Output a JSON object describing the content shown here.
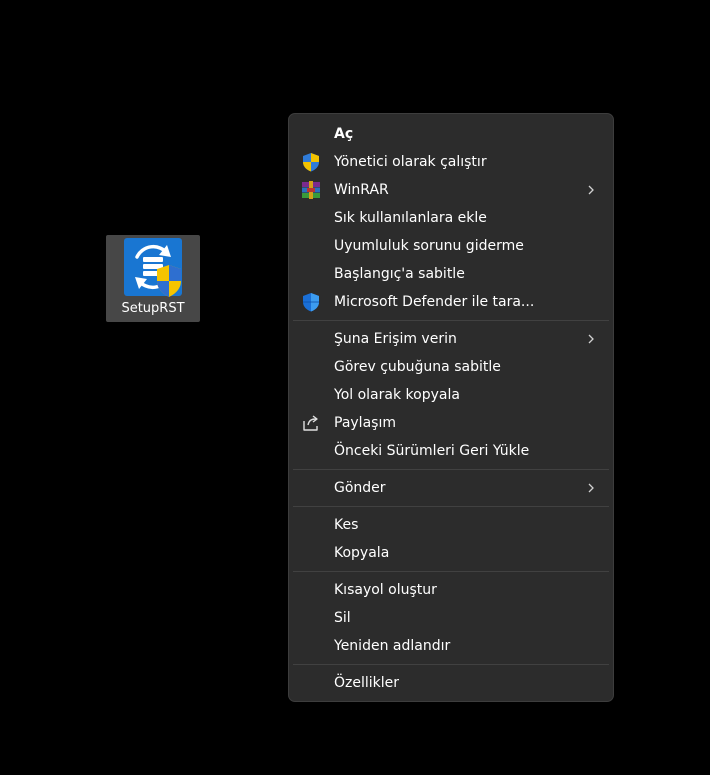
{
  "desktop": {
    "icon": {
      "label": "SetupRST",
      "icon_name": "setup-rst-icon"
    }
  },
  "context_menu": {
    "group1": [
      {
        "label": "Aç",
        "bold": true,
        "icon": null,
        "submenu": false
      },
      {
        "label": "Yönetici olarak çalıştır",
        "icon": "uac-shield-icon",
        "submenu": false
      },
      {
        "label": "WinRAR",
        "icon": "winrar-icon",
        "submenu": true
      },
      {
        "label": "Sık kullanılanlara ekle",
        "icon": null,
        "submenu": false
      },
      {
        "label": "Uyumluluk sorunu giderme",
        "icon": null,
        "submenu": false
      },
      {
        "label": "Başlangıç'a sabitle",
        "icon": null,
        "submenu": false
      },
      {
        "label": "Microsoft Defender ile tara...",
        "icon": "defender-shield-icon",
        "submenu": false
      }
    ],
    "group2": [
      {
        "label": "Şuna Erişim verin",
        "icon": null,
        "submenu": true
      },
      {
        "label": "Görev çubuğuna sabitle",
        "icon": null,
        "submenu": false
      },
      {
        "label": "Yol olarak kopyala",
        "icon": null,
        "submenu": false
      },
      {
        "label": "Paylaşım",
        "icon": "share-icon",
        "submenu": false
      },
      {
        "label": "Önceki Sürümleri Geri Yükle",
        "icon": null,
        "submenu": false
      }
    ],
    "group3": [
      {
        "label": "Gönder",
        "icon": null,
        "submenu": true
      }
    ],
    "group4": [
      {
        "label": "Kes",
        "icon": null,
        "submenu": false
      },
      {
        "label": "Kopyala",
        "icon": null,
        "submenu": false
      }
    ],
    "group5": [
      {
        "label": "Kısayol oluştur",
        "icon": null,
        "submenu": false
      },
      {
        "label": "Sil",
        "icon": null,
        "submenu": false
      },
      {
        "label": "Yeniden adlandır",
        "icon": null,
        "submenu": false
      }
    ],
    "group6": [
      {
        "label": "Özellikler",
        "icon": null,
        "submenu": false
      }
    ]
  },
  "colors": {
    "desktop_bg": "#000000",
    "menu_bg": "#2c2c2c",
    "separator": "#414141",
    "icon_selection": "#474747",
    "text": "#ffffff"
  }
}
